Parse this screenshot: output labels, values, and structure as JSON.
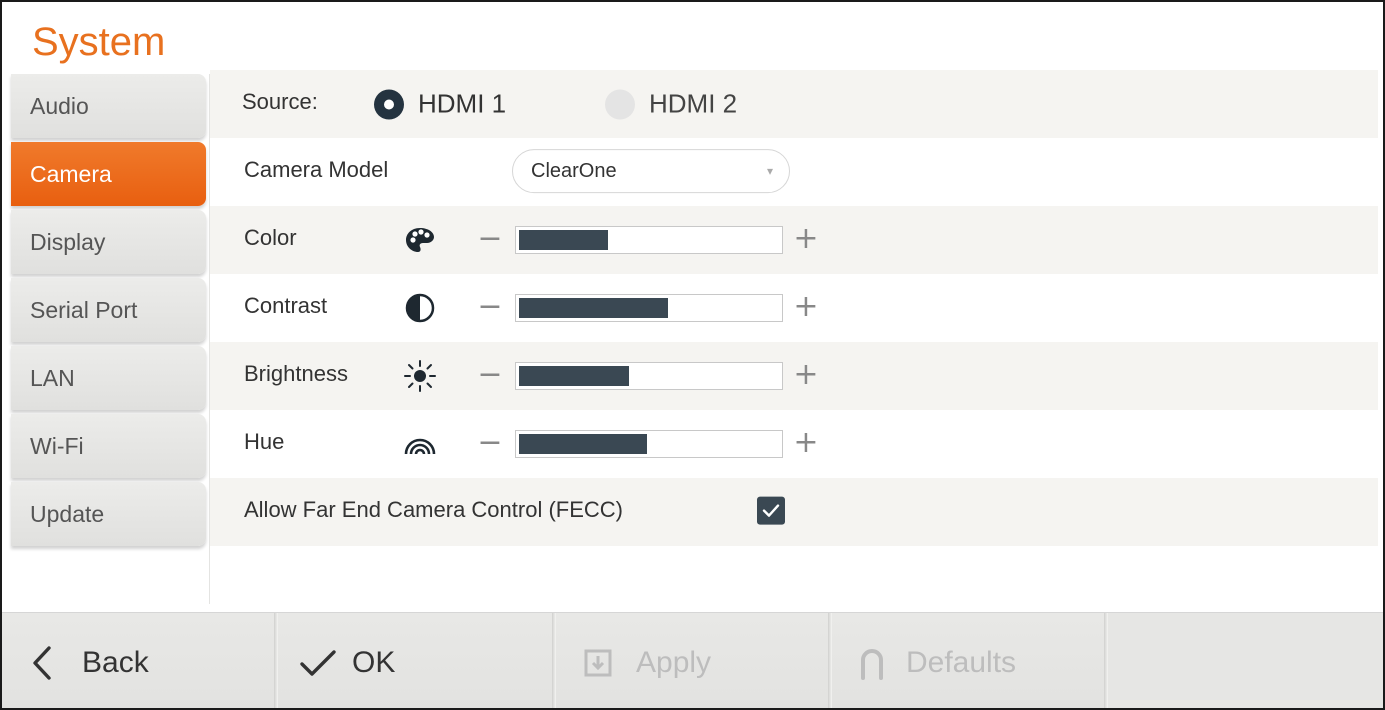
{
  "page": {
    "title": "System"
  },
  "sidebar": {
    "items": [
      {
        "label": "Audio",
        "active": false
      },
      {
        "label": "Camera",
        "active": true
      },
      {
        "label": "Display",
        "active": false
      },
      {
        "label": "Serial Port",
        "active": false
      },
      {
        "label": "LAN",
        "active": false
      },
      {
        "label": "Wi-Fi",
        "active": false
      },
      {
        "label": "Update",
        "active": false
      }
    ]
  },
  "camera": {
    "source": {
      "label": "Source:",
      "options": [
        {
          "label": "HDMI 1",
          "selected": true
        },
        {
          "label": "HDMI 2",
          "selected": false
        }
      ]
    },
    "model": {
      "label": "Camera Model",
      "value": "ClearOne"
    },
    "sliders": [
      {
        "label": "Color",
        "icon": "palette-icon",
        "level": 0.34
      },
      {
        "label": "Contrast",
        "icon": "contrast-icon",
        "level": 0.57
      },
      {
        "label": "Brightness",
        "icon": "brightness-icon",
        "level": 0.42
      },
      {
        "label": "Hue",
        "icon": "hue-icon",
        "level": 0.49
      }
    ],
    "decrease_symbol": "−",
    "increase_symbol": "+",
    "fecc": {
      "label": "Allow Far End Camera Control (FECC)",
      "checked": true
    }
  },
  "bottombar": {
    "back_label": "Back",
    "ok_label": "OK",
    "apply_label": "Apply",
    "defaults_label": "Defaults"
  },
  "colors": {
    "accent": "#e8711f",
    "active_tab": "#ef6a1a",
    "slider_fill": "#3a4853",
    "disabled_text": "#bdbdbd"
  }
}
